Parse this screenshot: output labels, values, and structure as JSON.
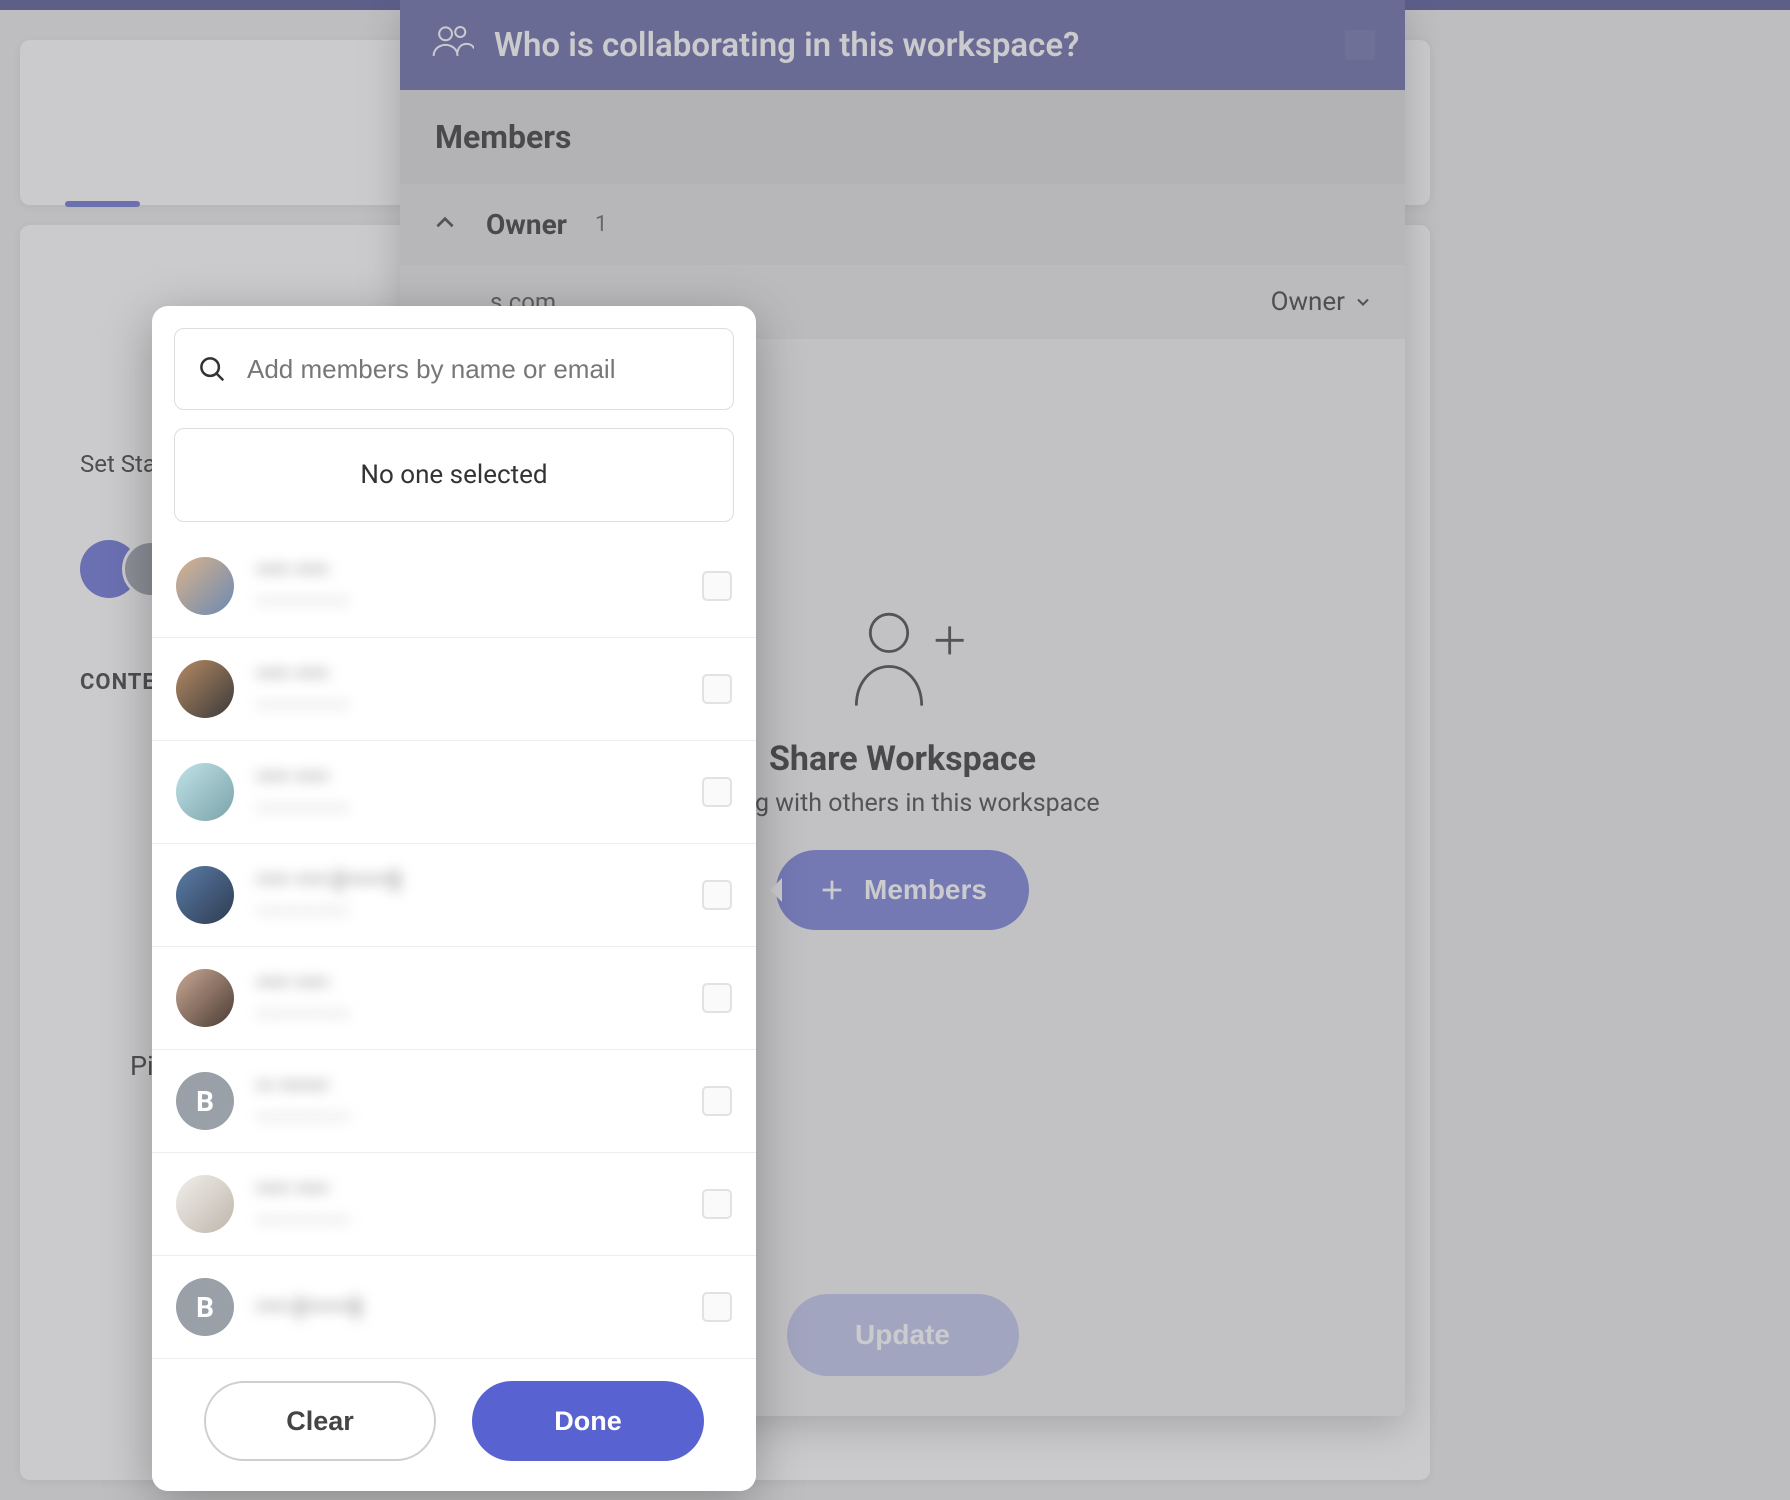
{
  "modal": {
    "title": "Who is collaborating in this workspace?",
    "members_heading": "Members",
    "owner_group_label": "Owner",
    "owner_group_count": "1",
    "owner_email_fragment": "s.com",
    "owner_role_label": "Owner",
    "empty_title": "Share Workspace",
    "empty_subtitle_fragment": "rating with others in this workspace",
    "members_button": "Members",
    "update_button": "Update"
  },
  "popover": {
    "search_placeholder": "Add members by name or email",
    "no_one_selected": "No one selected",
    "clear": "Clear",
    "done": "Done",
    "people": [
      {
        "avatar": "g1",
        "letter": "",
        "name": "—— ——",
        "email": "——————"
      },
      {
        "avatar": "g2",
        "letter": "",
        "name": "—— ——",
        "email": "——————"
      },
      {
        "avatar": "g3",
        "letter": "",
        "name": "—— ——",
        "email": "——————"
      },
      {
        "avatar": "g4",
        "letter": "",
        "name": "—— —— (———)",
        "email": "——————"
      },
      {
        "avatar": "g5",
        "letter": "",
        "name": "—— ——",
        "email": "——————"
      },
      {
        "avatar": "",
        "letter": "B",
        "name": "— ———",
        "email": "——————"
      },
      {
        "avatar": "g7",
        "letter": "",
        "name": "—— ——",
        "email": "——————"
      },
      {
        "avatar": "",
        "letter": "B",
        "name": "—— (———)",
        "email": ""
      }
    ]
  },
  "bg": {
    "set_status_fragment": "Set Sta",
    "content_fragment": "CONTE",
    "pi_fragment": "Pi"
  }
}
